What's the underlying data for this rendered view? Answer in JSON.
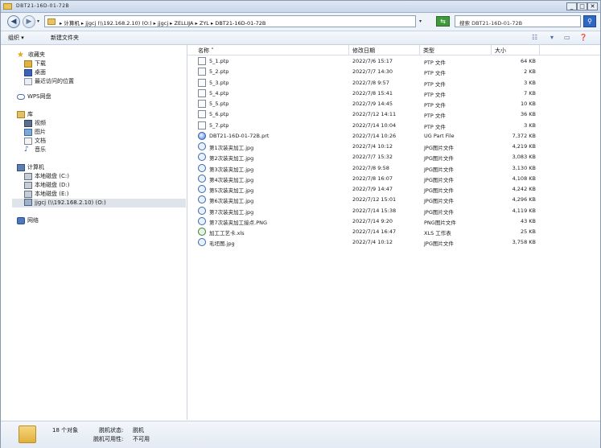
{
  "window": {
    "title": "DBT21-16D-01-72B",
    "buttons": {
      "minimize": "_",
      "maximize": "□",
      "close": "✕"
    }
  },
  "address_bar": {
    "path": "▸ 计算机 ▸ jjgcj (\\\\192.168.2.10) (O:) ▸ jjgcj ▸ ZELLIJA ▸ ZYL ▸ DBT21-16D-01-72B",
    "search_placeholder": "搜索 DBT21-16D-01-72B"
  },
  "toolbar": {
    "organize_label": "组织 ▾",
    "new_folder_label": "新建文件夹"
  },
  "sidebar": {
    "favorites": {
      "label": "收藏夹",
      "items": [
        "下载",
        "桌面",
        "最近访问的位置"
      ]
    },
    "wps": {
      "label": "WPS网盘"
    },
    "libraries": {
      "label": "库",
      "items": [
        "视频",
        "图片",
        "文档",
        "音乐"
      ]
    },
    "computer": {
      "label": "计算机",
      "items": [
        "本地磁盘 (C:)",
        "本地磁盘 (D:)",
        "本地磁盘 (E:)",
        "jjgcj (\\\\192.168.2.10) (O:)"
      ]
    },
    "network": {
      "label": "网络"
    },
    "selected": "jjgcj (\\\\192.168.2.10) (O:)"
  },
  "columns": {
    "name": "名称 ˄",
    "date": "修改日期",
    "type": "类型",
    "size": "大小"
  },
  "files": [
    {
      "icon": "ptp",
      "name": "5_1.ptp",
      "date": "2022/7/6 15:17",
      "type": "PTP 文件",
      "size": "64 KB"
    },
    {
      "icon": "ptp",
      "name": "5_2.ptp",
      "date": "2022/7/7 14:30",
      "type": "PTP 文件",
      "size": "2 KB"
    },
    {
      "icon": "ptp",
      "name": "5_3.ptp",
      "date": "2022/7/8 9:57",
      "type": "PTP 文件",
      "size": "3 KB"
    },
    {
      "icon": "ptp",
      "name": "5_4.ptp",
      "date": "2022/7/8 15:41",
      "type": "PTP 文件",
      "size": "7 KB"
    },
    {
      "icon": "ptp",
      "name": "5_5.ptp",
      "date": "2022/7/9 14:45",
      "type": "PTP 文件",
      "size": "10 KB"
    },
    {
      "icon": "ptp",
      "name": "5_6.ptp",
      "date": "2022/7/12 14:11",
      "type": "PTP 文件",
      "size": "36 KB"
    },
    {
      "icon": "ptp",
      "name": "5_7.ptp",
      "date": "2022/7/14 10:04",
      "type": "PTP 文件",
      "size": "3 KB"
    },
    {
      "icon": "prt",
      "name": "DBT21-16D-01-72B.prt",
      "date": "2022/7/14 10:26",
      "type": "UG Part File",
      "size": "7,372 KB"
    },
    {
      "icon": "jpg",
      "name": "第1次装夹加工.jpg",
      "date": "2022/7/4 10:12",
      "type": "JPG图片文件",
      "size": "4,219 KB"
    },
    {
      "icon": "jpg",
      "name": "第2次装夹加工.jpg",
      "date": "2022/7/7 15:32",
      "type": "JPG图片文件",
      "size": "3,083 KB"
    },
    {
      "icon": "jpg",
      "name": "第3次装夹加工.jpg",
      "date": "2022/7/8 9:58",
      "type": "JPG图片文件",
      "size": "3,130 KB"
    },
    {
      "icon": "jpg",
      "name": "第4次装夹加工.jpg",
      "date": "2022/7/8 16:07",
      "type": "JPG图片文件",
      "size": "4,108 KB"
    },
    {
      "icon": "jpg",
      "name": "第5次装夹加工.jpg",
      "date": "2022/7/9 14:47",
      "type": "JPG图片文件",
      "size": "4,242 KB"
    },
    {
      "icon": "jpg",
      "name": "第6次装夹加工.jpg",
      "date": "2022/7/12 15:01",
      "type": "JPG图片文件",
      "size": "4,296 KB"
    },
    {
      "icon": "jpg",
      "name": "第7次装夹加工.jpg",
      "date": "2022/7/14 15:38",
      "type": "JPG图片文件",
      "size": "4,119 KB"
    },
    {
      "icon": "jpg",
      "name": "第7次装夹加工接点.PNG",
      "date": "2022/7/14 9:20",
      "type": "PNG图片文件",
      "size": "43 KB"
    },
    {
      "icon": "xls",
      "name": "加工工艺卡.xls",
      "date": "2022/7/14 16:47",
      "type": "XLS 工作表",
      "size": "25 KB"
    },
    {
      "icon": "jpg",
      "name": "毛坯图.jpg",
      "date": "2022/7/4 10:12",
      "type": "JPG图片文件",
      "size": "3,758 KB"
    }
  ],
  "status": {
    "count": "18 个对象",
    "offline_status_label": "脱机状态:",
    "offline_status_value": "脱机",
    "offline_avail_label": "脱机可用性:",
    "offline_avail_value": "不可用"
  }
}
